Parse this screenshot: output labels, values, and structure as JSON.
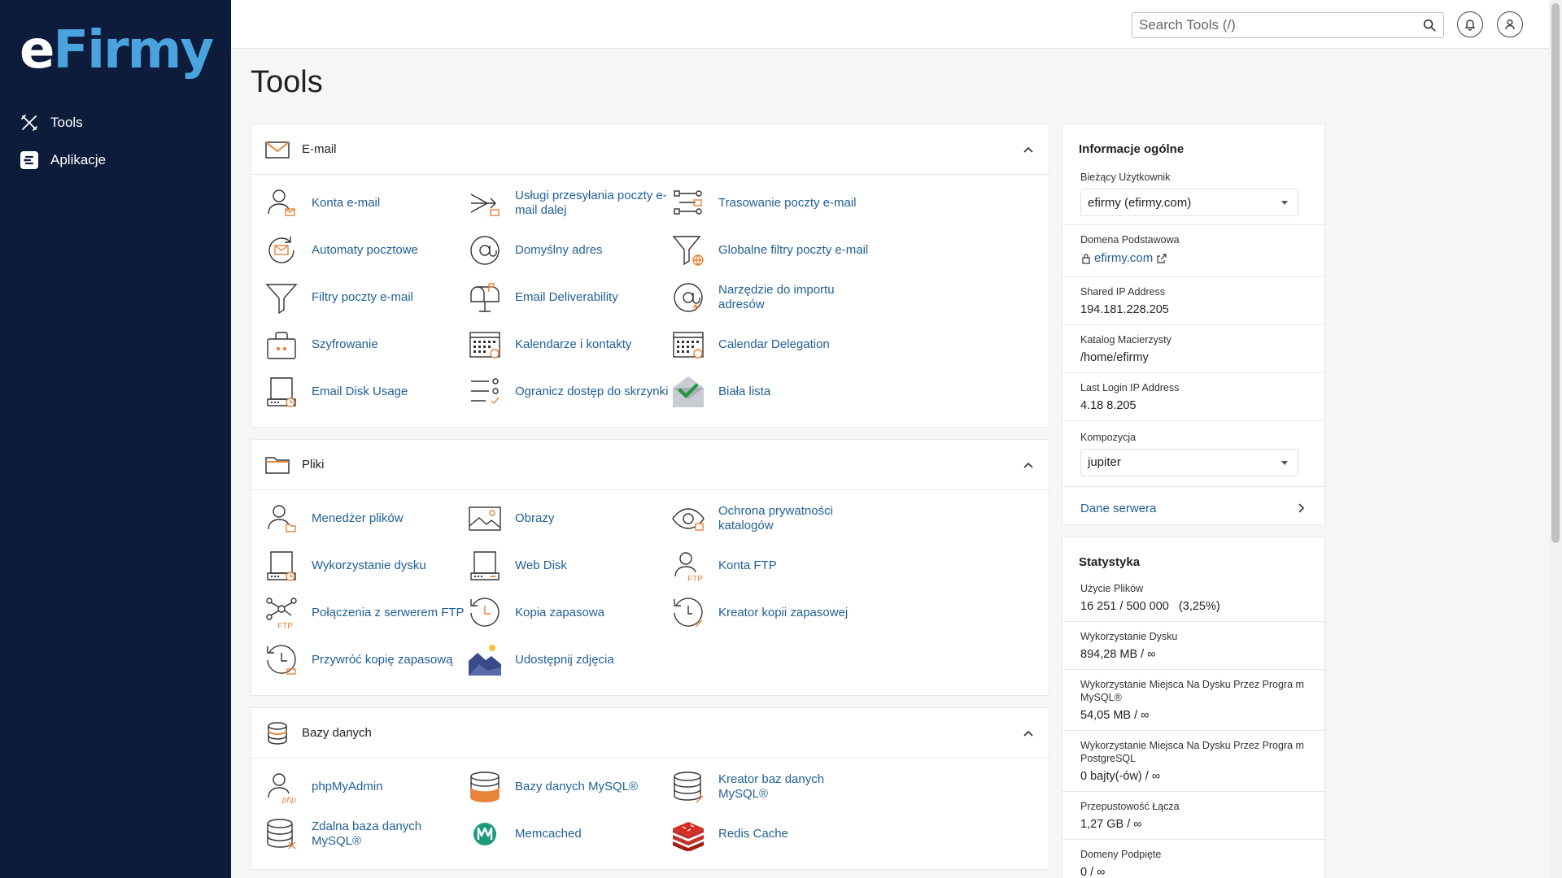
{
  "brand": {
    "part1": "e",
    "part2": "Firmy"
  },
  "nav": [
    {
      "label": "Tools",
      "icon": "tools-icon"
    },
    {
      "label": "Aplikacje",
      "icon": "applications-icon"
    }
  ],
  "topbar": {
    "search_placeholder": "Search Tools (/)"
  },
  "page": {
    "title": "Tools"
  },
  "sections": {
    "email": {
      "title": "E-mail",
      "items": [
        "Konta e-mail",
        "Usługi przesyłania poczty e-mail dalej",
        "Trasowanie poczty e-mail",
        "Automaty pocztowe",
        "Domyślny adres",
        "Globalne filtry poczty e-mail",
        "Filtry poczty e-mail",
        "Email Deliverability",
        "Narzędzie do importu adresów",
        "Szyfrowanie",
        "Kalendarze i kontakty",
        "Calendar Delegation",
        "Email Disk Usage",
        "Ogranicz dostęp do skrzynki",
        "Biała lista"
      ]
    },
    "files": {
      "title": "Pliki",
      "items": [
        "Menedżer plików",
        "Obrazy",
        "Ochrona prywatności katalogów",
        "Wykorzystanie dysku",
        "Web Disk",
        "Konta FTP",
        "Połączenia z serwerem FTP",
        "Kopia zapasowa",
        "Kreator kopii zapasowej",
        "Przywróć kopię zapasową",
        "Udostępnij zdjęcia"
      ]
    },
    "databases": {
      "title": "Bazy danych",
      "items": [
        "phpMyAdmin",
        "Bazy danych MySQL®",
        "Kreator baz danych MySQL®",
        "Zdalna baza danych MySQL®",
        "Memcached",
        "Redis Cache"
      ]
    }
  },
  "general_info": {
    "title": "Informacje ogólne",
    "current_user_label": "Bieżący Użytkownik",
    "current_user_value": "efirmy (efirmy.com)",
    "primary_domain_label": "Domena Podstawowa",
    "primary_domain_value": "efirmy.com",
    "shared_ip_label": "Shared IP Address",
    "shared_ip_value": "194.181.228.205",
    "home_dir_label": "Katalog Macierzysty",
    "home_dir_value": "/home/efirmy",
    "last_login_label": "Last Login IP Address",
    "last_login_value": "4.18 8.205",
    "theme_label": "Kompozycja",
    "theme_value": "jupiter",
    "server_info_label": "Dane serwera"
  },
  "stats": {
    "title": "Statystyka",
    "files_label": "Użycie Plików",
    "files_value": "16 251 / 500 000   (3,25%)",
    "disk_label": "Wykorzystanie Dysku",
    "disk_value": "894,28 MB / ∞",
    "mysql_label": "Wykorzystanie Miejsca Na Dysku Przez Progra m MySQL®",
    "mysql_value": "54,05 MB / ∞",
    "pg_label": "Wykorzystanie Miejsca Na Dysku Przez Progra m PostgreSQL",
    "pg_value": "0 bajty(-ów) / ∞",
    "bandwidth_label": "Przepustowość Łącza",
    "bandwidth_value": "1,27 GB / ∞",
    "addon_label": "Domeny Podpięte",
    "addon_value": "0 / ∞"
  },
  "colors": {
    "sidebar": "#0e1c3c",
    "link": "#1f5f95",
    "accent": "#e8833a",
    "brand_blue": "#4aa3df"
  }
}
